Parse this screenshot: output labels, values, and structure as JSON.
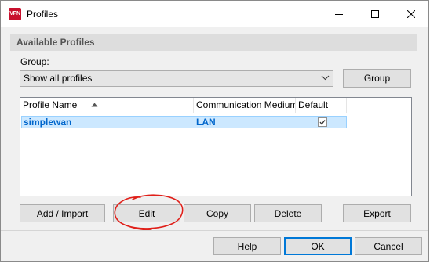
{
  "window": {
    "title": "Profiles",
    "app_icon_text": "VPN",
    "controls": [
      "minimize-icon",
      "maximize-icon",
      "close-icon"
    ]
  },
  "section": {
    "title": "Available Profiles"
  },
  "group": {
    "label": "Group:",
    "selected": "Show all profiles",
    "button_label": "Group"
  },
  "profiles_table": {
    "columns": [
      "Profile Name",
      "Communication Medium",
      "Default"
    ],
    "sort_indicator": "sort-ascending-icon",
    "rows": [
      {
        "profile_name": "simplewan",
        "medium": "LAN",
        "default": true,
        "selected": true
      }
    ]
  },
  "actions": {
    "add_import": "Add / Import",
    "edit": "Edit",
    "copy": "Copy",
    "delete": "Delete",
    "export": "Export"
  },
  "dialog_buttons": {
    "help": "Help",
    "ok": "OK",
    "cancel": "Cancel"
  },
  "colors": {
    "selection_fill": "#cce8ff",
    "selection_text": "#0066cc",
    "annotation": "#e0201a",
    "accent": "#0078d7"
  }
}
